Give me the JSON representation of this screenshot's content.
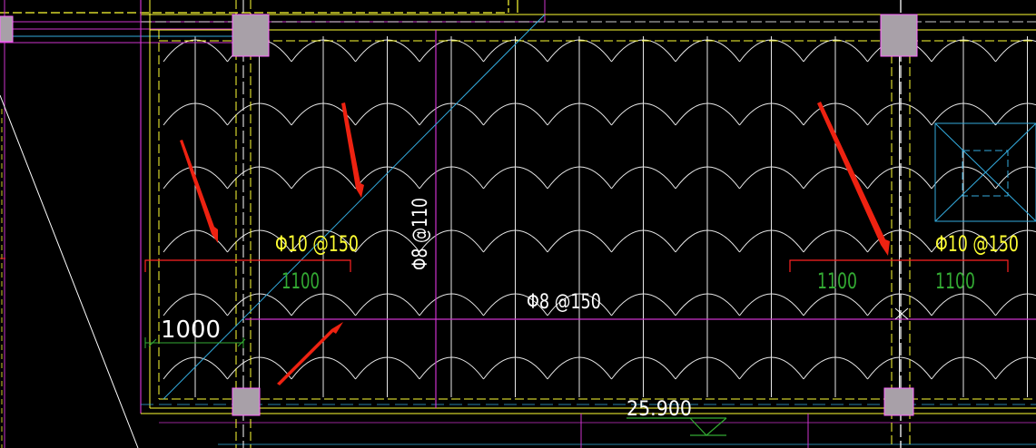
{
  "labels": {
    "rebar_left": "Φ10 @150",
    "rebar_right": "Φ10 @150",
    "rebar_vertical": "Φ8 @110",
    "rebar_mid": "Φ8 @150",
    "dim_left_1100": "1100",
    "dim_right_1100_a": "1100",
    "dim_right_1100_b": "1100",
    "dim_1000": "1000",
    "elevation": "25.900"
  },
  "colors": {
    "background": "#000000",
    "white": "#ffffff",
    "yellow": "#ffff33",
    "magenta": "#cc33cc",
    "red": "#ff2222",
    "green": "#33aa33",
    "cyan": "#33aadd",
    "column_gray": "#a8a0a8",
    "column_edge": "#ff66ff",
    "arrow_red": "#ee2211"
  }
}
